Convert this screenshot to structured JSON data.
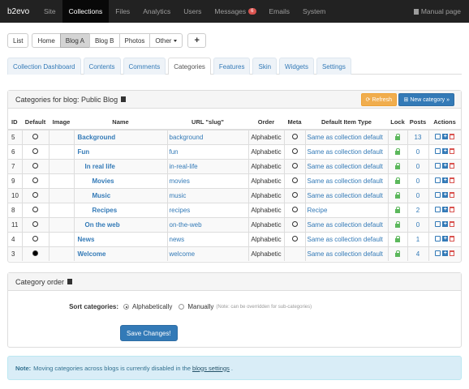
{
  "topbar": {
    "brand": "b2evo",
    "items": [
      "Site",
      "Collections",
      "Files",
      "Analytics",
      "Users",
      "Messages",
      "Emails",
      "System"
    ],
    "messages_badge": "6",
    "manual": "Manual page"
  },
  "toolbar": {
    "buttons": [
      "List",
      "Home",
      "Blog A",
      "Blog B",
      "Photos",
      "Other"
    ],
    "add": "+"
  },
  "tabs": [
    "Collection Dashboard",
    "Contents",
    "Comments",
    "Categories",
    "Features",
    "Skin",
    "Widgets",
    "Settings"
  ],
  "categories_panel": {
    "title": "Categories for blog: Public Blog",
    "refresh": "Refresh",
    "new_category": "New category »",
    "columns": [
      "ID",
      "Default",
      "Image",
      "Name",
      "URL \"slug\"",
      "Order",
      "Meta",
      "Default Item Type",
      "Lock",
      "Posts",
      "Actions"
    ],
    "rows": [
      {
        "id": "5",
        "name": "Background",
        "slug": "background",
        "order": "Alphabetic",
        "type": "Same as collection default",
        "posts": "13",
        "indent": 0,
        "def": false
      },
      {
        "id": "6",
        "name": "Fun",
        "slug": "fun",
        "order": "Alphabetic",
        "type": "Same as collection default",
        "posts": "0",
        "indent": 0,
        "def": false
      },
      {
        "id": "7",
        "name": "In real life",
        "slug": "in-real-life",
        "order": "Alphabetic",
        "type": "Same as collection default",
        "posts": "0",
        "indent": 1,
        "def": false
      },
      {
        "id": "9",
        "name": "Movies",
        "slug": "movies",
        "order": "Alphabetic",
        "type": "Same as collection default",
        "posts": "0",
        "indent": 2,
        "def": false
      },
      {
        "id": "10",
        "name": "Music",
        "slug": "music",
        "order": "Alphabetic",
        "type": "Same as collection default",
        "posts": "0",
        "indent": 2,
        "def": false
      },
      {
        "id": "8",
        "name": "Recipes",
        "slug": "recipes",
        "order": "Alphabetic",
        "type": "Recipe",
        "posts": "2",
        "indent": 2,
        "def": false
      },
      {
        "id": "11",
        "name": "On the web",
        "slug": "on-the-web",
        "order": "Alphabetic",
        "type": "Same as collection default",
        "posts": "0",
        "indent": 1,
        "def": false
      },
      {
        "id": "4",
        "name": "News",
        "slug": "news",
        "order": "Alphabetic",
        "type": "Same as collection default",
        "posts": "1",
        "indent": 0,
        "def": false
      },
      {
        "id": "3",
        "name": "Welcome",
        "slug": "welcome",
        "order": "Alphabetic",
        "type": "Same as collection default",
        "posts": "4",
        "indent": 0,
        "def": true
      }
    ]
  },
  "order_panel": {
    "title": "Category order",
    "sort_label": "Sort categories:",
    "alpha": "Alphabetically",
    "manual": "Manually",
    "hint": "(Note: can be overridden for sub-categories)",
    "save": "Save Changes!"
  },
  "note": {
    "strong": "Note:",
    "text1": "Moving categories across blogs is currently disabled in the",
    "link": "blogs settings",
    "text2": "."
  }
}
